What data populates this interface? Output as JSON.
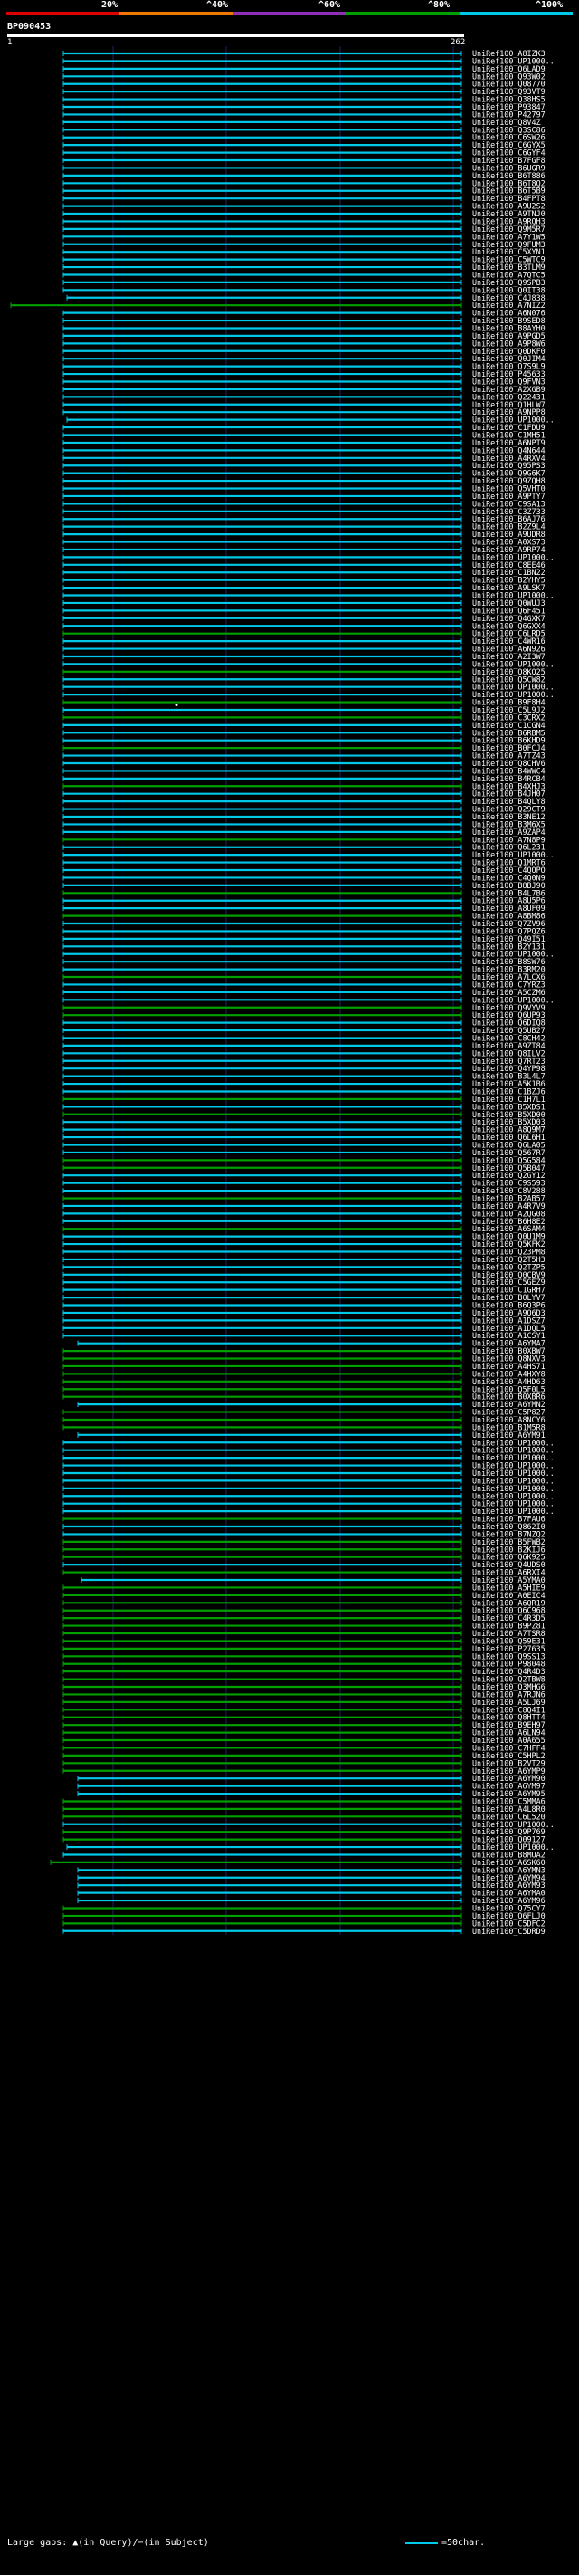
{
  "scale": {
    "labels": [
      "20%",
      "^40%",
      "^60%",
      "^80%",
      "^100%"
    ],
    "colors": [
      "#e00000",
      "#f07800",
      "#9030b8",
      "#00a000",
      "#00c8e8"
    ]
  },
  "query": {
    "id": "BP090453",
    "start": "1",
    "end": "262"
  },
  "colors": {
    "cyan": "#00c8e8",
    "green": "#00a000",
    "gridline": "#202060",
    "label": "#ffffff"
  },
  "hits": [
    {
      "id": "UniRef100_A8IZK3",
      "c": "c"
    },
    {
      "id": "UniRef100_UP1000..",
      "c": "c"
    },
    {
      "id": "UniRef100_Q6LAD9",
      "c": "c"
    },
    {
      "id": "UniRef100_Q93W02",
      "c": "c"
    },
    {
      "id": "UniRef100_Q08770",
      "c": "c"
    },
    {
      "id": "UniRef100_Q93VT9",
      "c": "c"
    },
    {
      "id": "UniRef100_Q38HS5",
      "c": "c"
    },
    {
      "id": "UniRef100_P93847",
      "c": "c"
    },
    {
      "id": "UniRef100_P42797",
      "c": "c"
    },
    {
      "id": "UniRef100_Q8V4Z",
      "c": "c"
    },
    {
      "id": "UniRef100_Q3SC86",
      "c": "c"
    },
    {
      "id": "UniRef100_C6SW26",
      "c": "c"
    },
    {
      "id": "UniRef100_C6GYX5",
      "c": "c"
    },
    {
      "id": "UniRef100_C6GYF4",
      "c": "c"
    },
    {
      "id": "UniRef100_B7FGF8",
      "c": "c"
    },
    {
      "id": "UniRef100_B6UGR9",
      "c": "c"
    },
    {
      "id": "UniRef100_B6T886",
      "c": "c"
    },
    {
      "id": "UniRef100_B6T8Q2",
      "c": "c"
    },
    {
      "id": "UniRef100_B6T5B9",
      "c": "c"
    },
    {
      "id": "UniRef100_B4FPT8",
      "c": "c"
    },
    {
      "id": "UniRef100_A9U2S2",
      "c": "c"
    },
    {
      "id": "UniRef100_A9TNJ0",
      "c": "c"
    },
    {
      "id": "UniRef100_A9RQH3",
      "c": "c"
    },
    {
      "id": "UniRef100_Q9M5R7",
      "c": "c"
    },
    {
      "id": "UniRef100_A7Y1W5",
      "c": "c"
    },
    {
      "id": "UniRef100_Q9FUM3",
      "c": "c"
    },
    {
      "id": "UniRef100_C5XYN1",
      "c": "c"
    },
    {
      "id": "UniRef100_C5WTC9",
      "c": "c"
    },
    {
      "id": "UniRef100_B3TLM9",
      "c": "c"
    },
    {
      "id": "UniRef100_A7QTC5",
      "c": "c"
    },
    {
      "id": "UniRef100_Q9SPB3",
      "c": "c"
    },
    {
      "id": "UniRef100_Q0IT38",
      "c": "c"
    },
    {
      "id": "UniRef100_C4J838",
      "c": "c",
      "x": 74
    },
    {
      "id": "UniRef100_A7NIZ2",
      "c": "g",
      "x": 12
    },
    {
      "id": "UniRef100_A6N076",
      "c": "c"
    },
    {
      "id": "UniRef100_B9SED8",
      "c": "c"
    },
    {
      "id": "UniRef100_B8AYH0",
      "c": "c"
    },
    {
      "id": "UniRef100_A9PGD5",
      "c": "c"
    },
    {
      "id": "UniRef100_A9P8W6",
      "c": "c"
    },
    {
      "id": "UniRef100_Q0DKF0",
      "c": "c"
    },
    {
      "id": "UniRef100_Q0JIM4",
      "c": "c"
    },
    {
      "id": "UniRef100_Q7S9L9",
      "c": "c"
    },
    {
      "id": "UniRef100_P45633",
      "c": "c"
    },
    {
      "id": "UniRef100_Q9FVN3",
      "c": "c"
    },
    {
      "id": "UniRef100_A2XGB9",
      "c": "c"
    },
    {
      "id": "UniRef100_Q22431",
      "c": "c"
    },
    {
      "id": "UniRef100_Q1HLW7",
      "c": "c"
    },
    {
      "id": "UniRef100_A9NPP8",
      "c": "c"
    },
    {
      "id": "UniRef100_UP1000..",
      "c": "c",
      "x": 74
    },
    {
      "id": "UniRef100_C1FDU9",
      "c": "c"
    },
    {
      "id": "UniRef100_C1MH51",
      "c": "c"
    },
    {
      "id": "UniRef100_A6NPT9",
      "c": "c"
    },
    {
      "id": "UniRef100_Q4N644",
      "c": "c"
    },
    {
      "id": "UniRef100_A4RXV4",
      "c": "c"
    },
    {
      "id": "UniRef100_Q95PS3",
      "c": "c"
    },
    {
      "id": "UniRef100_Q9G6K7",
      "c": "c"
    },
    {
      "id": "UniRef100_Q9ZQH8",
      "c": "c"
    },
    {
      "id": "UniRef100_Q5VHT0",
      "c": "c"
    },
    {
      "id": "UniRef100_A9PTY7",
      "c": "c"
    },
    {
      "id": "UniRef100_C9SA13",
      "c": "c"
    },
    {
      "id": "UniRef100_C3Z733",
      "c": "c"
    },
    {
      "id": "UniRef100_B6AJ76",
      "c": "c"
    },
    {
      "id": "UniRef100_B2Z9L4",
      "c": "c"
    },
    {
      "id": "UniRef100_A9UDR8",
      "c": "c"
    },
    {
      "id": "UniRef100_A0XS73",
      "c": "c"
    },
    {
      "id": "UniRef100_A9RP74",
      "c": "c"
    },
    {
      "id": "UniRef100_UP1000..",
      "c": "c"
    },
    {
      "id": "UniRef100_C8EE46",
      "c": "c"
    },
    {
      "id": "UniRef100_C1BN22",
      "c": "c"
    },
    {
      "id": "UniRef100_B2YHY5",
      "c": "c"
    },
    {
      "id": "UniRef100_A9LSK7",
      "c": "c"
    },
    {
      "id": "UniRef100_UP1000..",
      "c": "c"
    },
    {
      "id": "UniRef100_Q0WUJ3",
      "c": "c"
    },
    {
      "id": "UniRef100_Q6F451",
      "c": "c"
    },
    {
      "id": "UniRef100_Q4GXK7",
      "c": "c"
    },
    {
      "id": "UniRef100_Q6GXX4",
      "c": "c"
    },
    {
      "id": "UniRef100_C6LRD5",
      "c": "g"
    },
    {
      "id": "UniRef100_C4WR16",
      "c": "c"
    },
    {
      "id": "UniRef100_A6N926",
      "c": "c"
    },
    {
      "id": "UniRef100_A2I3W7",
      "c": "c"
    },
    {
      "id": "UniRef100_UP1000..",
      "c": "c"
    },
    {
      "id": "UniRef100_Q8KQ25",
      "c": "g"
    },
    {
      "id": "UniRef100_Q5CW82",
      "c": "c"
    },
    {
      "id": "UniRef100_UP1000..",
      "c": "c"
    },
    {
      "id": "UniRef100_UP1000..",
      "c": "c"
    },
    {
      "id": "UniRef100_B9F8H4",
      "c": "g",
      "dot": true
    },
    {
      "id": "UniRef100_C5L9J2",
      "c": "c"
    },
    {
      "id": "UniRef100_C3CRX2",
      "c": "g"
    },
    {
      "id": "UniRef100_C1CGN4",
      "c": "c"
    },
    {
      "id": "UniRef100_B6RBM5",
      "c": "c"
    },
    {
      "id": "UniRef100_B6KHD9",
      "c": "c"
    },
    {
      "id": "UniRef100_B0FCJ4",
      "c": "g"
    },
    {
      "id": "UniRef100_A7TZ43",
      "c": "c"
    },
    {
      "id": "UniRef100_Q8CHV6",
      "c": "c"
    },
    {
      "id": "UniRef100_B4WWC4",
      "c": "c"
    },
    {
      "id": "UniRef100_B4RCB4",
      "c": "c"
    },
    {
      "id": "UniRef100_B4XHJ3",
      "c": "g"
    },
    {
      "id": "UniRef100_B4JH07",
      "c": "c"
    },
    {
      "id": "UniRef100_B4QLY8",
      "c": "c"
    },
    {
      "id": "UniRef100_Q29CT9",
      "c": "c"
    },
    {
      "id": "UniRef100_B3NE12",
      "c": "c"
    },
    {
      "id": "UniRef100_B3M6X5",
      "c": "c"
    },
    {
      "id": "UniRef100_A9ZAP4",
      "c": "c"
    },
    {
      "id": "UniRef100_A7N8P9",
      "c": "g"
    },
    {
      "id": "UniRef100_Q6L231",
      "c": "c"
    },
    {
      "id": "UniRef100_UP1000..",
      "c": "c"
    },
    {
      "id": "UniRef100_Q1MRT6",
      "c": "c"
    },
    {
      "id": "UniRef100_C4QOPO",
      "c": "c"
    },
    {
      "id": "UniRef100_C4Q0N9",
      "c": "c"
    },
    {
      "id": "UniRef100_B8BJ90",
      "c": "c"
    },
    {
      "id": "UniRef100_B4L7B6",
      "c": "g"
    },
    {
      "id": "UniRef100_A8U5P6",
      "c": "c"
    },
    {
      "id": "UniRef100_A8UF09",
      "c": "c"
    },
    {
      "id": "UniRef100_A8BM86",
      "c": "g"
    },
    {
      "id": "UniRef100_Q7ZV96",
      "c": "c"
    },
    {
      "id": "UniRef100_Q7PQZ6",
      "c": "c"
    },
    {
      "id": "UniRef100_Q49I51",
      "c": "c"
    },
    {
      "id": "UniRef100_B2Y131",
      "c": "c"
    },
    {
      "id": "UniRef100_UP1000..",
      "c": "c"
    },
    {
      "id": "UniRef100_B8SW76",
      "c": "c"
    },
    {
      "id": "UniRef100_B3RM20",
      "c": "c"
    },
    {
      "id": "UniRef100_A7LCX6",
      "c": "g"
    },
    {
      "id": "UniRef100_C7YRZ3",
      "c": "c"
    },
    {
      "id": "UniRef100_A5CZM6",
      "c": "c"
    },
    {
      "id": "UniRef100_UP1000..",
      "c": "c"
    },
    {
      "id": "UniRef100_Q9VYV9",
      "c": "g"
    },
    {
      "id": "UniRef100_Q6UP93",
      "c": "g"
    },
    {
      "id": "UniRef100_Q6DIQ8",
      "c": "c"
    },
    {
      "id": "UniRef100_Q5UB27",
      "c": "c"
    },
    {
      "id": "UniRef100_C8CH42",
      "c": "c"
    },
    {
      "id": "UniRef100_A9ZT84",
      "c": "c"
    },
    {
      "id": "UniRef100_Q8ILV2",
      "c": "c"
    },
    {
      "id": "UniRef100_Q7RT23",
      "c": "c"
    },
    {
      "id": "UniRef100_Q4YP98",
      "c": "c"
    },
    {
      "id": "UniRef100_B3L4L7",
      "c": "c"
    },
    {
      "id": "UniRef100_A5K1B6",
      "c": "c"
    },
    {
      "id": "UniRef100_C1BZJ6",
      "c": "c"
    },
    {
      "id": "UniRef100_C1H7L1",
      "c": "g"
    },
    {
      "id": "UniRef100_B5XDS1",
      "c": "c"
    },
    {
      "id": "UniRef100_B5XD00",
      "c": "g"
    },
    {
      "id": "UniRef100_B5XD03",
      "c": "c"
    },
    {
      "id": "UniRef100_A8Q9M7",
      "c": "c"
    },
    {
      "id": "UniRef100_Q6L6H1",
      "c": "c"
    },
    {
      "id": "UniRef100_Q6LA05",
      "c": "c"
    },
    {
      "id": "UniRef100_Q567R7",
      "c": "c"
    },
    {
      "id": "UniRef100_Q5G584",
      "c": "g"
    },
    {
      "id": "UniRef100_Q5B047",
      "c": "g"
    },
    {
      "id": "UniRef100_Q2GY12",
      "c": "c"
    },
    {
      "id": "UniRef100_C9S593",
      "c": "c"
    },
    {
      "id": "UniRef100_C8V288",
      "c": "c"
    },
    {
      "id": "UniRef100_B2AB57",
      "c": "g"
    },
    {
      "id": "UniRef100_A4R7V9",
      "c": "c"
    },
    {
      "id": "UniRef100_A2QG08",
      "c": "c"
    },
    {
      "id": "UniRef100_B6H8E2",
      "c": "c"
    },
    {
      "id": "UniRef100_A6SAM4",
      "c": "g"
    },
    {
      "id": "UniRef100_Q0U1M9",
      "c": "c"
    },
    {
      "id": "UniRef100_Q5KFK2",
      "c": "c"
    },
    {
      "id": "UniRef100_Q23PM8",
      "c": "c"
    },
    {
      "id": "UniRef100_Q2T5H3",
      "c": "c"
    },
    {
      "id": "UniRef100_Q2TZP5",
      "c": "c"
    },
    {
      "id": "UniRef100_Q0CBV9",
      "c": "c"
    },
    {
      "id": "UniRef100_C5GEZ9",
      "c": "c"
    },
    {
      "id": "UniRef100_C1GRH7",
      "c": "c"
    },
    {
      "id": "UniRef100_B0LYV7",
      "c": "c"
    },
    {
      "id": "UniRef100_B6Q3P6",
      "c": "c"
    },
    {
      "id": "UniRef100_A9Q6D3",
      "c": "c"
    },
    {
      "id": "UniRef100_A1DSZ7",
      "c": "c"
    },
    {
      "id": "UniRef100_A1DQL5",
      "c": "c"
    },
    {
      "id": "UniRef100_A1CSY1",
      "c": "c"
    },
    {
      "id": "UniRef100_A6YMA7",
      "c": "c",
      "x": 86
    },
    {
      "id": "UniRef100_B0XBW7",
      "c": "g"
    },
    {
      "id": "UniRef100_Q8NXV3",
      "c": "g"
    },
    {
      "id": "UniRef100_A4HS71",
      "c": "g"
    },
    {
      "id": "UniRef100_A4HXY8",
      "c": "g"
    },
    {
      "id": "UniRef100_A4HD63",
      "c": "g"
    },
    {
      "id": "UniRef100_Q5F0L5",
      "c": "g"
    },
    {
      "id": "UniRef100_B0XBR6",
      "c": "g"
    },
    {
      "id": "UniRef100_A6YMN2",
      "c": "c",
      "x": 86
    },
    {
      "id": "UniRef100_C5P827",
      "c": "g"
    },
    {
      "id": "UniRef100_A8NCY6",
      "c": "g"
    },
    {
      "id": "UniRef100_B1M5R8",
      "c": "g"
    },
    {
      "id": "UniRef100_A6YM91",
      "c": "c",
      "x": 86
    },
    {
      "id": "UniRef100_UP1000..",
      "c": "c"
    },
    {
      "id": "UniRef100_UP1000..",
      "c": "c"
    },
    {
      "id": "UniRef100_UP1000..",
      "c": "c"
    },
    {
      "id": "UniRef100_UP1000..",
      "c": "c"
    },
    {
      "id": "UniRef100_UP1000..",
      "c": "c"
    },
    {
      "id": "UniRef100_UP1000..",
      "c": "c"
    },
    {
      "id": "UniRef100_UP1000..",
      "c": "c"
    },
    {
      "id": "UniRef100_UP1000..",
      "c": "c"
    },
    {
      "id": "UniRef100_UP1000..",
      "c": "c"
    },
    {
      "id": "UniRef100_UP1000..",
      "c": "c"
    },
    {
      "id": "UniRef100_B7FAU6",
      "c": "g"
    },
    {
      "id": "UniRef100_Q862I0",
      "c": "c"
    },
    {
      "id": "UniRef100_B7NZQ2",
      "c": "c"
    },
    {
      "id": "UniRef100_B5FWB2",
      "c": "g"
    },
    {
      "id": "UniRef100_B2KIJ6",
      "c": "g"
    },
    {
      "id": "UniRef100_Q6K925",
      "c": "g"
    },
    {
      "id": "UniRef100_Q4UDS0",
      "c": "c"
    },
    {
      "id": "UniRef100_A6RXI4",
      "c": "g"
    },
    {
      "id": "UniRef100_A5YMA0",
      "c": "c",
      "x": 90
    },
    {
      "id": "UniRef100_A5HIE9",
      "c": "g"
    },
    {
      "id": "UniRef100_A0EIC4",
      "c": "g"
    },
    {
      "id": "UniRef100_A6QR19",
      "c": "g"
    },
    {
      "id": "UniRef100_Q6C968",
      "c": "g"
    },
    {
      "id": "UniRef100_C4R3D5",
      "c": "g"
    },
    {
      "id": "UniRef100_B9PZ81",
      "c": "g"
    },
    {
      "id": "UniRef100_A7TSR8",
      "c": "g"
    },
    {
      "id": "UniRef100_Q59E31",
      "c": "g"
    },
    {
      "id": "UniRef100_P27635",
      "c": "g"
    },
    {
      "id": "UniRef100_Q9SS13",
      "c": "g"
    },
    {
      "id": "UniRef100_P98048",
      "c": "g"
    },
    {
      "id": "UniRef100_Q4R4D3",
      "c": "g"
    },
    {
      "id": "UniRef100_Q2TBW8",
      "c": "g"
    },
    {
      "id": "UniRef100_Q3MHG6",
      "c": "g"
    },
    {
      "id": "UniRef100_A7RJN6",
      "c": "g"
    },
    {
      "id": "UniRef100_A5LJ69",
      "c": "g"
    },
    {
      "id": "UniRef100_C8Q4I1",
      "c": "g"
    },
    {
      "id": "UniRef100_Q8HTT4",
      "c": "g"
    },
    {
      "id": "UniRef100_B9EH97",
      "c": "g"
    },
    {
      "id": "UniRef100_A6LN94",
      "c": "g"
    },
    {
      "id": "UniRef100_A0A655",
      "c": "g"
    },
    {
      "id": "UniRef100_C7HFF4",
      "c": "g"
    },
    {
      "id": "UniRef100_C5HPL2",
      "c": "g"
    },
    {
      "id": "UniRef100_B2VT29",
      "c": "g"
    },
    {
      "id": "UniRef100_A6YMP9",
      "c": "g"
    },
    {
      "id": "UniRef100_A6YM90",
      "c": "c",
      "x": 86
    },
    {
      "id": "UniRef100_A6YM97",
      "c": "c",
      "x": 86
    },
    {
      "id": "UniRef100_A6YM95",
      "c": "c",
      "x": 86
    },
    {
      "id": "UniRef100_C5MMA6",
      "c": "g"
    },
    {
      "id": "UniRef100_A4L8R0",
      "c": "g"
    },
    {
      "id": "UniRef100_C6L520",
      "c": "g"
    },
    {
      "id": "UniRef100_UP1000..",
      "c": "c"
    },
    {
      "id": "UniRef100_Q9P769",
      "c": "g"
    },
    {
      "id": "UniRef100_Q09127",
      "c": "g"
    },
    {
      "id": "UniRef100_UP1000..",
      "c": "c",
      "x": 74
    },
    {
      "id": "UniRef100_B8MUA2",
      "c": "c"
    },
    {
      "id": "UniRef100_A6SK60",
      "c": "g",
      "x": 56
    },
    {
      "id": "UniRef100_A6YMN3",
      "c": "c",
      "x": 86
    },
    {
      "id": "UniRef100_A6YM94",
      "c": "c",
      "x": 86
    },
    {
      "id": "UniRef100_A6YM93",
      "c": "c",
      "x": 86
    },
    {
      "id": "UniRef100_A6YMA0",
      "c": "c",
      "x": 86
    },
    {
      "id": "UniRef100_A6YM96",
      "c": "c",
      "x": 86
    },
    {
      "id": "UniRef100_Q75CY7",
      "c": "g"
    },
    {
      "id": "UniRef100_Q6FLJ0",
      "c": "g"
    },
    {
      "id": "UniRef100_C5DFC2",
      "c": "g"
    },
    {
      "id": "UniRef100_C5DRD9",
      "c": "c"
    }
  ],
  "footer": {
    "left": "Large gaps: ▲(in Query)/−(in Subject)",
    "right": "=50char."
  }
}
